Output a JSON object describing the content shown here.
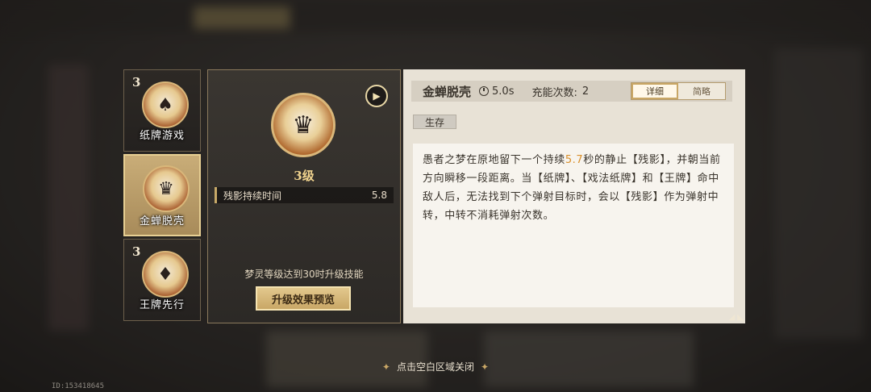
{
  "skills": [
    {
      "level": "3",
      "name": "纸牌游戏",
      "selected": false
    },
    {
      "level": "",
      "name": "金蝉脱壳",
      "selected": true
    },
    {
      "level": "3",
      "name": "王牌先行",
      "selected": false
    }
  ],
  "middle": {
    "level_label": "3级",
    "stat_name": "残影持续时间",
    "stat_value": "5.8",
    "upgrade_hint": "梦灵等级达到30时升级技能",
    "preview_button": "升级效果预览"
  },
  "detail": {
    "title": "金蝉脱壳",
    "cooldown": "5.0s",
    "charge_label": "充能次数:",
    "charge_value": "2",
    "tabs": [
      "详细",
      "简略"
    ],
    "tag": "生存",
    "desc_before": "愚者之梦在原地留下一个持续",
    "desc_highlight": "5.7",
    "desc_after": "秒的静止【残影】，并朝当前方向瞬移一段距离。当【纸牌】、【戏法纸牌】和【王牌】命中敌人后，无法找到下个弹射目标时，会以【残影】作为弹射中转，中转不消耗弹射次数。"
  },
  "close_hint": "点击空白区域关闭",
  "uid": "ID:153418645",
  "colors": {
    "accent": "#c9a766",
    "highlight": "#d98f2b"
  }
}
